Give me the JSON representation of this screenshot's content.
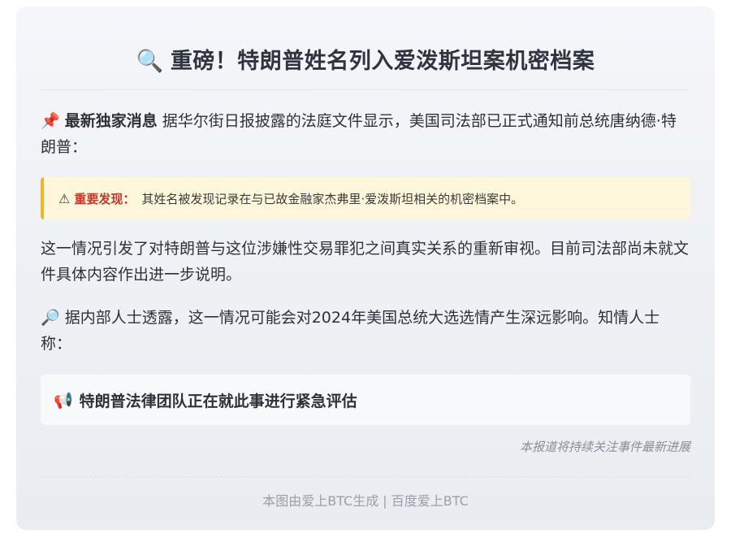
{
  "header": {
    "icon": "🔍",
    "icon_name": "magnifier-icon",
    "title": "重磅！特朗普姓名列入爱泼斯坦案机密档案"
  },
  "intro": {
    "icon": "📌",
    "icon_name": "pushpin-icon",
    "lead": "最新独家消息",
    "text": "据华尔街日报披露的法庭文件显示，美国司法部已正式通知前总统唐纳德·特朗普："
  },
  "alert": {
    "icon": "⚠",
    "icon_name": "warning-icon",
    "label": "重要发现：",
    "text": "其姓名被发现记录在与已故金融家杰弗里·爱泼斯坦相关的机密档案中。"
  },
  "paragraph2": "这一情况引发了对特朗普与这位涉嫌性交易罪犯之间真实关系的重新审视。目前司法部尚未就文件具体内容作出进一步说明。",
  "paragraph3": {
    "icon": "🔎",
    "icon_name": "magnifier-right-icon",
    "text": "据内部人士透露，这一情况可能会对2024年美国总统大选选情产生深远影响。知情人士称："
  },
  "callout": {
    "icon": "📢",
    "icon_name": "megaphone-icon",
    "text": "特朗普法律团队正在就此事进行紧急评估"
  },
  "note": "本报道将持续关注事件最新进展",
  "footer": "本图由爱上BTC生成 | 百度爱上BTC",
  "colors": {
    "alert_border": "#f0b429",
    "alert_bg": "#fff7db",
    "alert_label": "#c0392b"
  }
}
